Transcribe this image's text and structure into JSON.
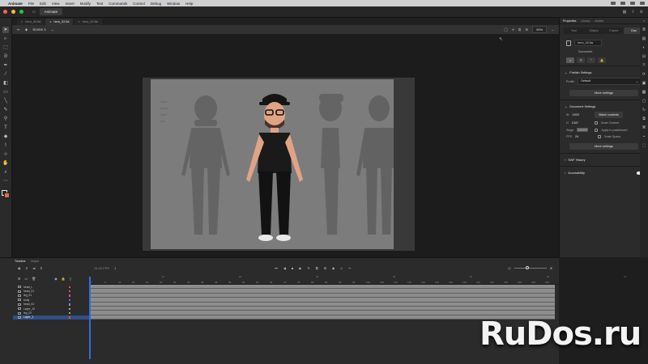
{
  "menubar": {
    "app_name": "Animate",
    "items": [
      "File",
      "Edit",
      "View",
      "Insert",
      "Modify",
      "Text",
      "Commands",
      "Control",
      "Debug",
      "Window",
      "Help"
    ]
  },
  "titlebar": {
    "app_tab": "Animate",
    "lights": [
      "#ff5f57",
      "#febc2e",
      "#28c840"
    ]
  },
  "doc_tabs": [
    "hero_02.fla",
    "hero_02.fla",
    "hero_02.fla"
  ],
  "editbar": {
    "scene": "Scene 1",
    "zoom": "50%"
  },
  "tools": [
    "select-arrow",
    "subselect",
    "free-transform",
    "lasso",
    "pen",
    "text",
    "line",
    "rectangle",
    "oval",
    "pencil",
    "brush",
    "paint-bucket",
    "eyedropper",
    "eraser",
    "bone",
    "hand",
    "zoom"
  ],
  "swatch": {
    "stroke": "#ffffff",
    "fill": "#e66a4a"
  },
  "right_panel": {
    "tabs": [
      "Properties",
      "Library",
      "Assets"
    ],
    "subtabs": [
      "Tool",
      "Object",
      "Frame",
      "Doc"
    ],
    "doc_name": "hero_02.fla",
    "doc_label": "Document",
    "publish_section": "Publish Settings",
    "profile_label": "Profile",
    "profile_value": "Default",
    "more_settings": "More settings",
    "doc_settings_section": "Document Settings",
    "width_label": "W",
    "width_value": "1920",
    "height_label": "H",
    "height_value": "1347",
    "match_contents": "Match contents",
    "scale_content": "Scale Content",
    "stage_label": "Stage",
    "apply_pasteboard": "Apply to pasteboard",
    "fps_label": "FPS",
    "fps_value": "24",
    "scale_spans": "Scale Spans",
    "more_settings_2": "More settings",
    "swf_history": "SWF History",
    "accessibility": "Accessibility"
  },
  "timeline": {
    "tabs": [
      "Timeline",
      "Output"
    ],
    "frame_readout": "24.00 FPS",
    "frame_num": "1",
    "layers": [
      "head_L",
      "head_01",
      "leg_01",
      "body",
      "head_02",
      "Layer_10",
      "leg_02",
      "Layer_1"
    ],
    "layer_colors": [
      "#e84b4b",
      "#e84b4b",
      "#e0479a",
      "#7b5cf0",
      "#4aa7e0",
      "#e09b2d",
      "#6ad36a",
      "#e84b4b"
    ],
    "ruler_ticks": [
      "1",
      "5",
      "10",
      "15",
      "20",
      "25",
      "30",
      "35",
      "40",
      "45",
      "50",
      "55",
      "60",
      "65",
      "70",
      "75",
      "80",
      "85",
      "90",
      "95",
      "100",
      "105",
      "110",
      "115",
      "120",
      "125",
      "130",
      "135",
      "140",
      "145",
      "150",
      "155",
      "160",
      "165"
    ],
    "ruler_seconds": [
      "1s",
      "2s",
      "3s",
      "4s",
      "5s",
      "6s",
      "7s"
    ]
  },
  "watermark": "RuDos.ru"
}
